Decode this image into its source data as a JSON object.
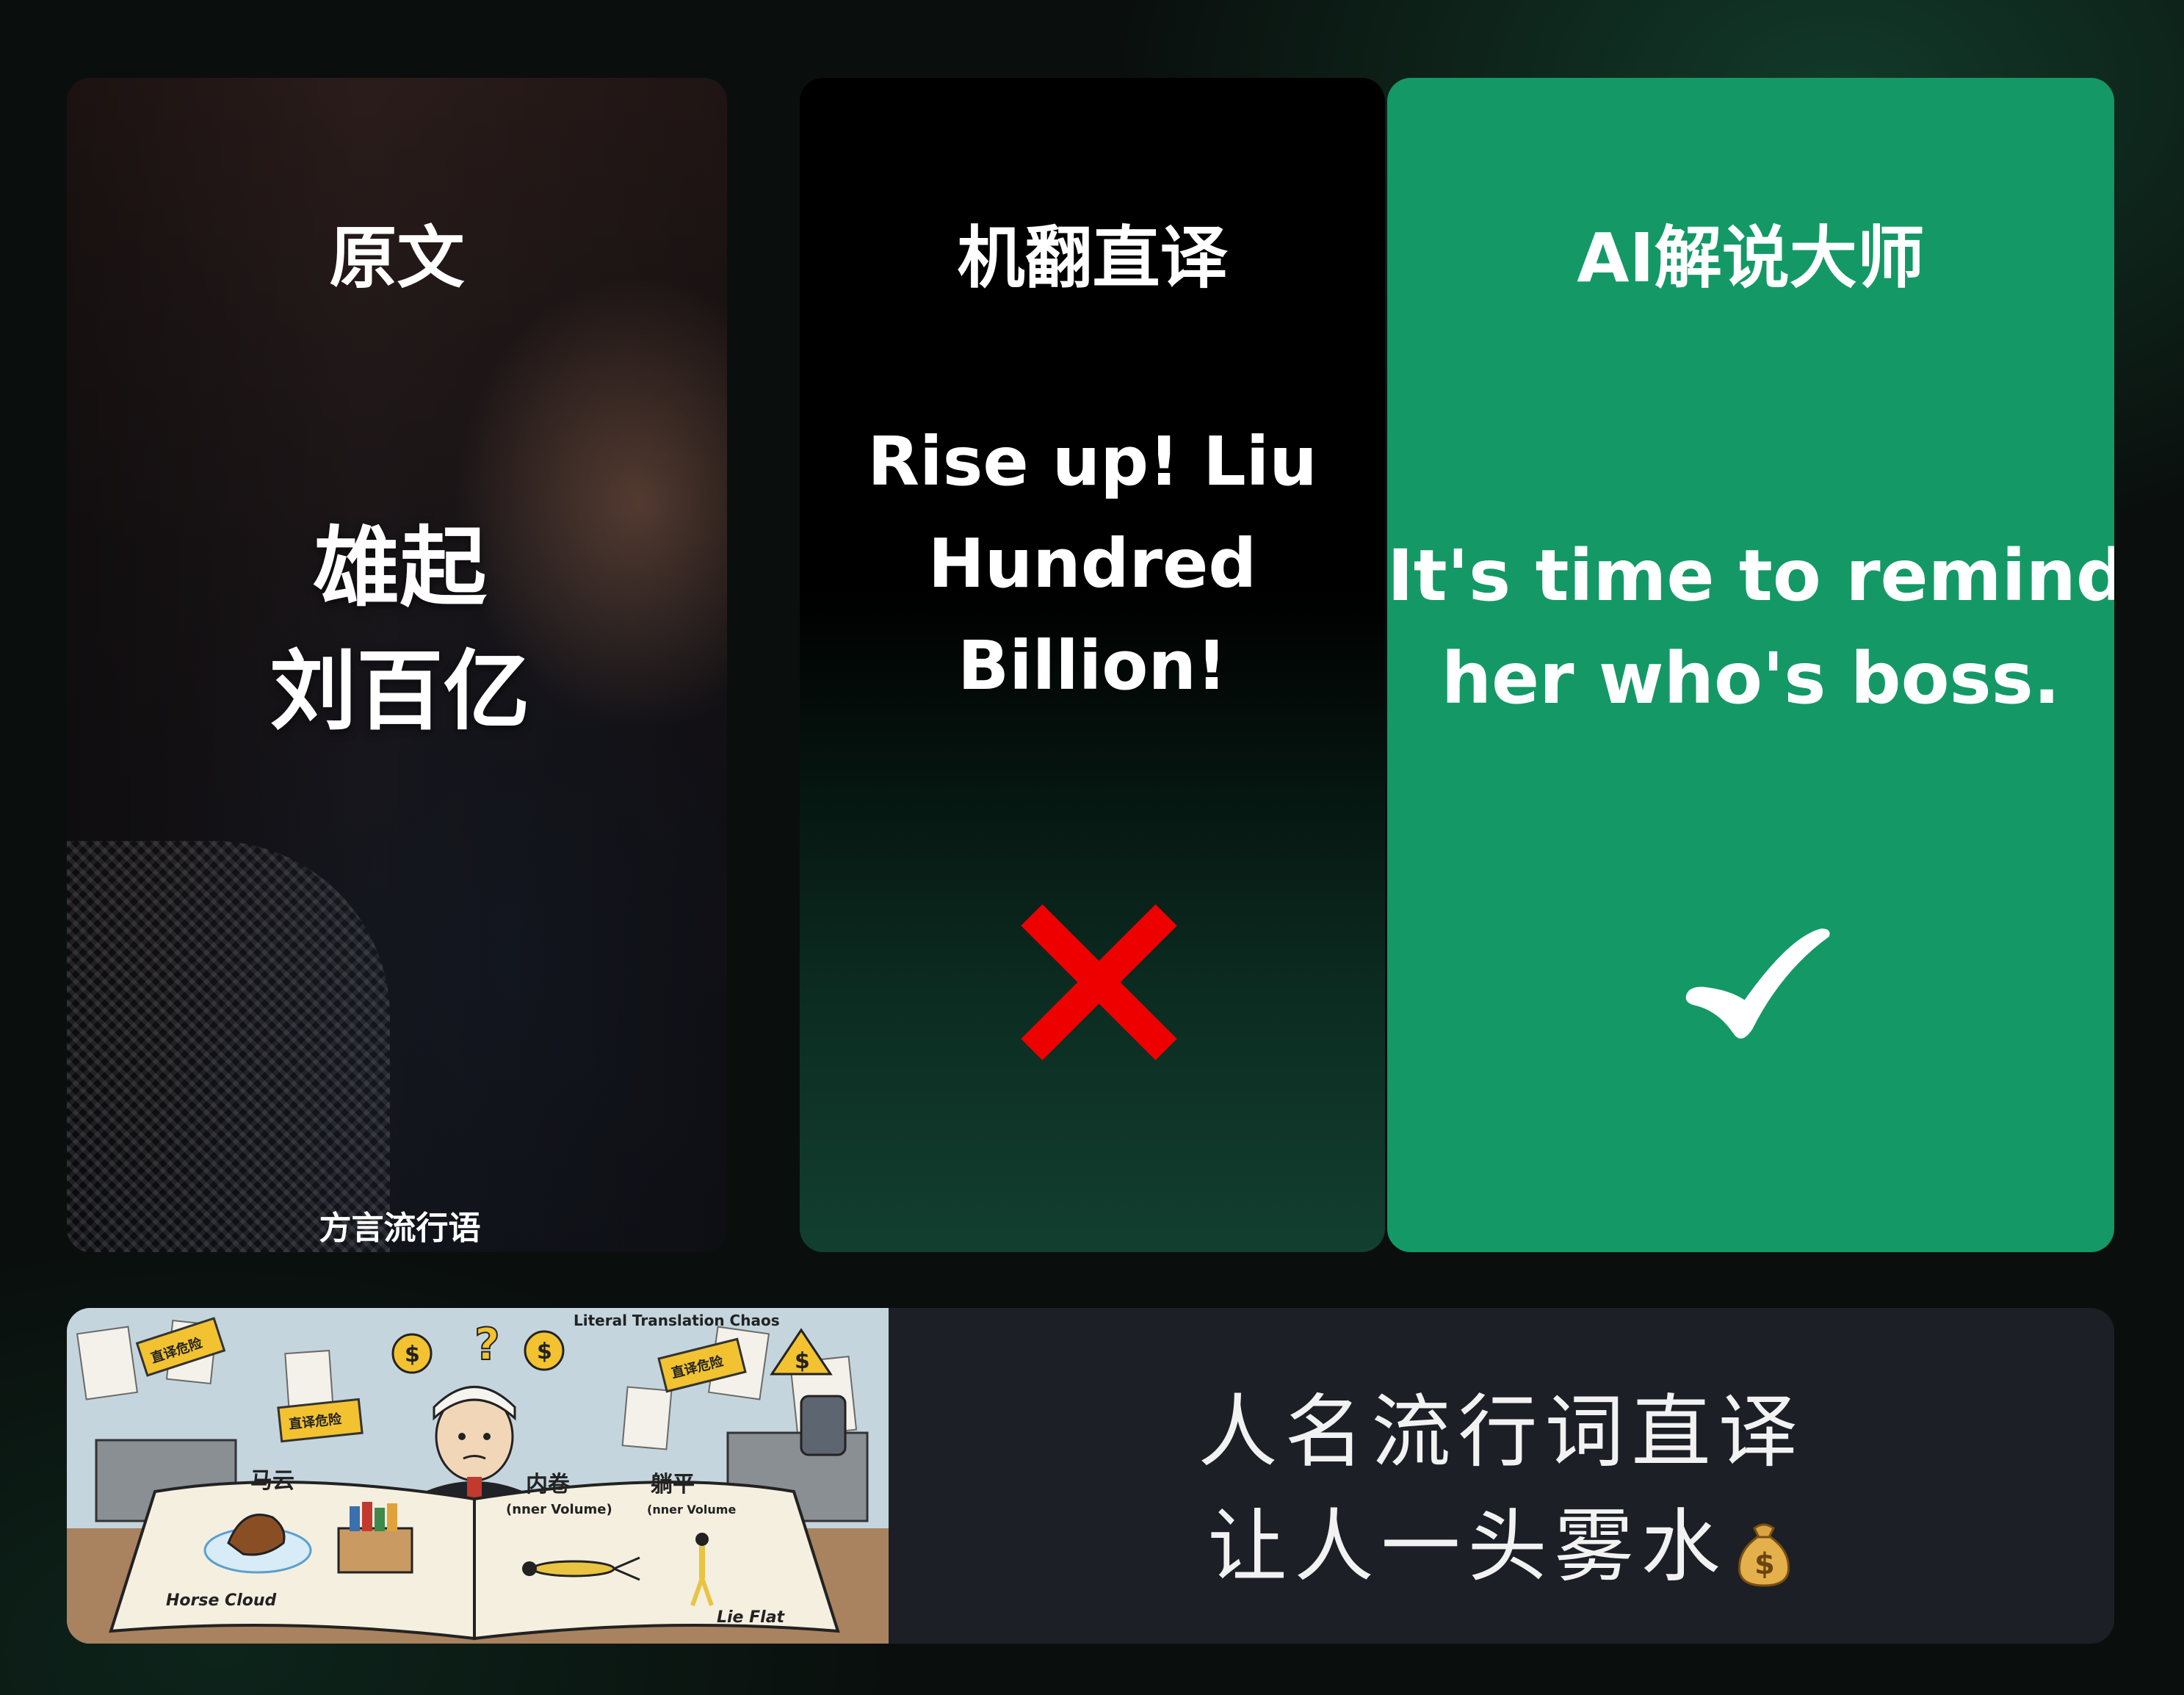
{
  "columns": {
    "original": {
      "title": "原文",
      "text_lines": [
        "雄起",
        "刘百亿"
      ],
      "footnote": "方言流行语"
    },
    "machine": {
      "title": "机翻直译",
      "text_lines": [
        "Rise up! Liu",
        "Hundred",
        "Billion!"
      ],
      "verdict_icon": "red-x-icon"
    },
    "ai": {
      "title": "AI解说大师",
      "text_lines": [
        "It's time to remind",
        "her who's boss."
      ],
      "verdict_icon": "white-check-icon"
    }
  },
  "banner": {
    "illustration": {
      "heading": "Literal   Translation  Chaos",
      "stickers": [
        "直译危险",
        "直译危险",
        "直译危险"
      ],
      "book_left": {
        "term": "马云",
        "gloss": "Horse Cloud"
      },
      "book_right": [
        {
          "term": "内卷",
          "gloss": "(nner Volume)"
        },
        {
          "term": "躺平",
          "gloss": "(nner Volume"
        }
      ],
      "book_right_caption": "Lie Flat"
    },
    "caption_lines": [
      "人名流行词直译",
      "让人一头雾水"
    ],
    "caption_icon": "money-bag-icon"
  },
  "colors": {
    "ai_panel": "#149966",
    "cross": "#ee0000",
    "banner_bg": "#1c1f25"
  }
}
